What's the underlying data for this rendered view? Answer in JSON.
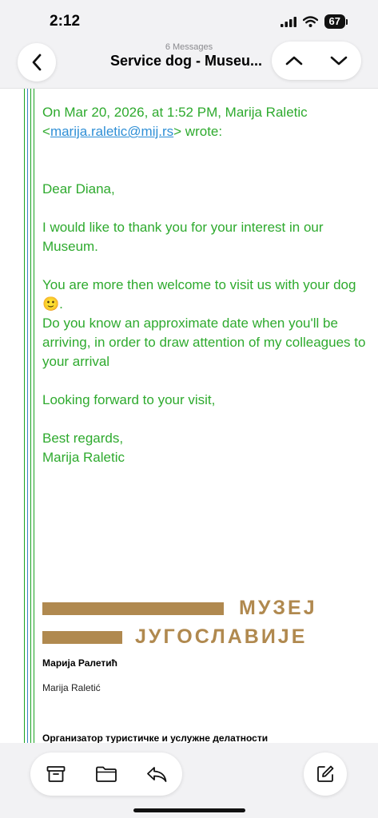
{
  "status": {
    "time": "2:12",
    "battery": "67"
  },
  "nav": {
    "message_count": "6 Messages",
    "title": "Service dog - Museu..."
  },
  "quote": {
    "header_prefix": "On Mar 20, 2026, at 1:52 PM, Marija Raletic",
    "open_angle": "<",
    "email": "marija.raletic@mij.rs",
    "header_suffix": "> wrote:",
    "greeting": "Dear Diana,",
    "para1": "I would like to thank you for your interest in our Museum.",
    "para2": "You are more then welcome to visit us with your dog",
    "emoji": "🙂",
    "para2_end": ".",
    "para3": "Do you know an approximate date when you'll be arriving, in order to draw attention of my colleagues to your arrival",
    "para4": "Looking forward to your visit,",
    "closing": "Best regards,",
    "name": "Marija Raletic"
  },
  "logo": {
    "line1": "МУЗЕЈ",
    "line2": "ЈУГОСЛАВИЈЕ",
    "color": "#b0894f"
  },
  "signature": {
    "name_cyrillic": "Марија Ралетић",
    "name_latin": "Marija Raletić",
    "org_line": "Организатор туристичке и услужне делатности"
  },
  "colors": {
    "quote_text": "#2eaa2e",
    "link": "#2f8fd6"
  },
  "icons": {
    "back": "chevron-left-icon",
    "prev": "chevron-up-icon",
    "next": "chevron-down-icon",
    "archive": "archive-icon",
    "folder": "folder-icon",
    "reply": "reply-icon",
    "compose": "compose-icon"
  }
}
